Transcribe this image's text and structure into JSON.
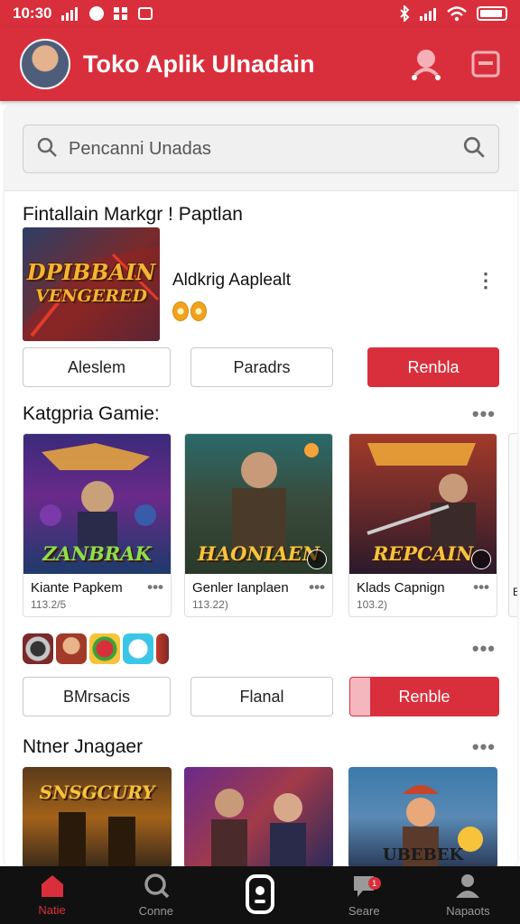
{
  "status_bar": {
    "time": "10:30",
    "icons": [
      "signal-icon",
      "notification-icon",
      "grid-icon",
      "message-icon",
      "bluetooth-icon",
      "wifi-icon",
      "battery-icon"
    ]
  },
  "app_bar": {
    "title": "Toko Aplik Ulnadain",
    "actions": [
      "profile-search-icon",
      "wallet-icon"
    ]
  },
  "search": {
    "placeholder": "Pencanni Unadas"
  },
  "featured": {
    "section_title": "Fintallain Markgr ! Paptlan",
    "art_text_line1": "DPIBBAIN",
    "art_text_line2": "VENGERED",
    "app_name": "Aldkrig Aaplealt",
    "buttons": [
      "Aleslem",
      "Paradrs",
      "Renbla"
    ]
  },
  "category": {
    "section_title": "Katgpria Gamie:",
    "cards": [
      {
        "name": "Kiante Papkem",
        "size": "113.2/5",
        "art_text": "ZANBRAK"
      },
      {
        "name": "Genler Ianplaen",
        "size": "113.22)",
        "art_text": "HAONIAEN"
      },
      {
        "name": "Klads Capnign",
        "size": "103.2)",
        "art_text": "REPCAIN"
      }
    ],
    "peek_text": "E"
  },
  "mini_row": {
    "buttons": [
      "BMrsacis",
      "Flanal",
      "Renble"
    ]
  },
  "more": {
    "section_title": "Ntner Jnagaer",
    "cards": [
      {
        "art_text": "SNSGCURY"
      },
      {
        "art_text": ""
      },
      {
        "art_text": "UBEBEK"
      }
    ]
  },
  "bottom_nav": [
    {
      "label": "Natie",
      "icon": "home-icon",
      "active": true
    },
    {
      "label": "Conne",
      "icon": "search-icon",
      "active": false
    },
    {
      "label": "",
      "icon": "gamepad-icon",
      "active": false
    },
    {
      "label": "Seare",
      "icon": "chat-icon",
      "active": false,
      "badge": "1"
    },
    {
      "label": "Napaots",
      "icon": "profile-icon",
      "active": false
    }
  ],
  "colors": {
    "accent": "#d92f3c",
    "nav_bg": "#111111"
  }
}
